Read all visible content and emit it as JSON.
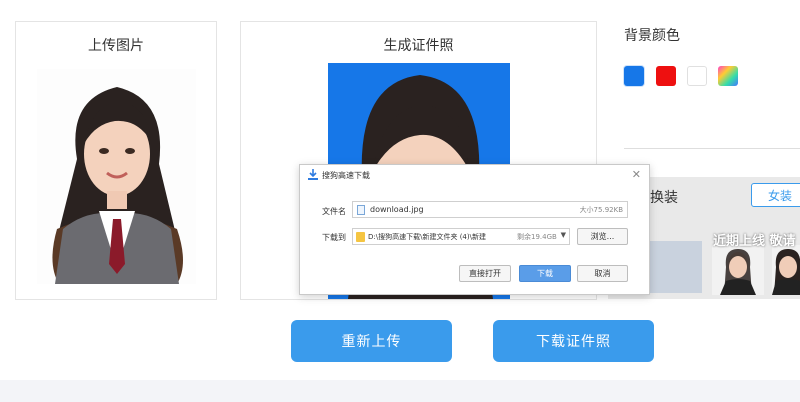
{
  "upload_panel": {
    "title": "上传图片"
  },
  "result_panel": {
    "title": "生成证件照"
  },
  "background": {
    "title": "背景颜色",
    "swatches": [
      {
        "name": "blue",
        "color": "#1677e8"
      },
      {
        "name": "red",
        "color": "#ee1010"
      },
      {
        "name": "white",
        "color": "#ffffff"
      },
      {
        "name": "gradient",
        "color": "gradient"
      }
    ]
  },
  "outfit": {
    "title": "换装",
    "tab_label": "女装",
    "banner": "近期上线 敬请"
  },
  "actions": {
    "reupload_label": "重新上传",
    "download_label": "下载证件照"
  },
  "dialog": {
    "title": "搜狗高速下载",
    "filename_label": "文件名",
    "filename": "download.jpg",
    "size_text": "大小75.92KB",
    "saveto_label": "下载到",
    "path": "D:\\搜狗高速下载\\新建文件夹 (4)\\新建",
    "free_text": "剩余19.4GB",
    "browse_label": "浏览...",
    "open_label": "直接打开",
    "download_label": "下载",
    "cancel_label": "取消"
  }
}
